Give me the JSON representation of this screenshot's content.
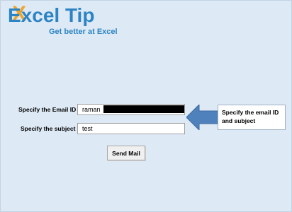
{
  "logo": {
    "brand_text": "Excel Tip",
    "tagline": "Get better at Excel"
  },
  "form": {
    "email_label": "Specify the Email ID",
    "email_value": "raman",
    "subject_label": "Specify the subject",
    "subject_value": "test",
    "send_button_label": "Send Mail"
  },
  "callout": {
    "text": "Specify the email ID\nand subject"
  },
  "colors": {
    "panel_background": "#dde9f5",
    "brand_blue": "#2d84c4",
    "brand_orange": "#f0a52a",
    "arrow_blue": "#4f81bd"
  },
  "icons": {
    "arrow": "left-arrow-icon"
  }
}
